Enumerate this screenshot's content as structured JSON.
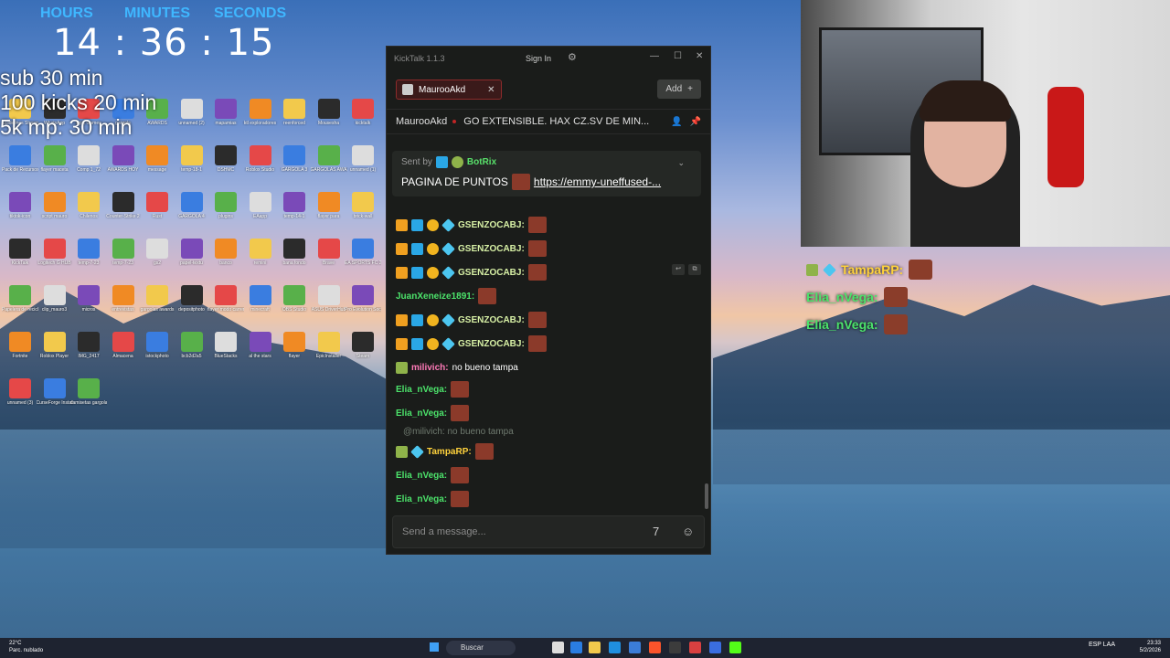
{
  "overlay": {
    "timer_labels": [
      "HOURS",
      "MINUTES",
      "SECONDS"
    ],
    "timer_value": "14 : 36 : 15",
    "lines": [
      "sub 30 min",
      "100 kicks 20 min",
      "5k mp: 30 min"
    ]
  },
  "desktop_icons": [
    "Guidelines Stream",
    "WhatsApp",
    "Epic Games",
    "gargola",
    "AWARDS",
    "unnamed (2)",
    "mapamias",
    "ktl exploradores",
    "reenforced",
    "Mousesha",
    "kicktalk",
    "Pack de Recursos",
    "flayer maceta",
    "Comp 1_72",
    "AWARDS HOY",
    "message",
    "temp-18-1",
    "DSHMC",
    "Roblox Studio",
    "GARGOLA 3",
    "GARGOLAS AWARD",
    "unnamed (1)",
    "tiktok-icon",
    "script mauro",
    "Chilenos",
    "Counter-Strike 2",
    "Rust",
    "GARGOLA 4",
    "plugins",
    "EAapp",
    "temp-14-1",
    "flayer para",
    "brick-wall",
    "KickTalk",
    "Logitech G HUB",
    "temp-7-23",
    "temp-7-23",
    "gs2",
    "papel-textu",
    "banco",
    "remini",
    "bana fondo",
    "Brave",
    "EA SPORTS FC 26",
    "Papelera de reciclaje",
    "clip_mauro3",
    "micros",
    "entrevistas",
    "gargolas awards",
    "depositphoto",
    "flayer modo carrera",
    "minecraft",
    "OBS Studio",
    "ASUS DriverHub",
    "Pro Evolution Soccer 6",
    "Fortnite",
    "Roblox Player",
    "IMG_2417",
    "Almacena",
    "istockphoto",
    "bcb2d2a5",
    "BlueStacks",
    "al the stars",
    "flayer",
    "EpicInstaller",
    "Steam",
    "unnamed (3)",
    "CurseForge Installer",
    "camisetas gargolas"
  ],
  "kicktalk": {
    "app_title": "KickTalk 1.1.3",
    "sign_in": "Sign In",
    "tab_label": "MaurooAkd",
    "add_label": "Add",
    "channel_name": "MaurooAkd",
    "stream_title": "GO EXTENSIBLE. HAX CZ.SV DE MIN...",
    "pinned": {
      "sent_by_label": "Sent by",
      "sender": "BotRix",
      "text": "PAGINA DE PUNTOS",
      "link": "https://emmy-uneffused-..."
    },
    "messages": [
      {
        "user": "GSENZOCABJ:",
        "text": ""
      },
      {
        "user": "GSENZOCABJ:",
        "text": ""
      },
      {
        "user": "GSENZOCABJ:",
        "text": ""
      },
      {
        "user": "JuanXeneize1891:",
        "text": ""
      },
      {
        "user": "GSENZOCABJ:",
        "text": ""
      },
      {
        "user": "GSENZOCABJ:",
        "text": ""
      },
      {
        "user": "milivich:",
        "text": "no bueno tampa"
      },
      {
        "user": "Elia_nVega:",
        "text": ""
      },
      {
        "user": "Elia_nVega:",
        "text": ""
      },
      {
        "user": "TampaRP:",
        "text": ""
      },
      {
        "user": "Elia_nVega:",
        "text": ""
      },
      {
        "user": "Elia_nVega:",
        "text": ""
      }
    ],
    "reply_context": "@milivich: no bueno tampa",
    "input_placeholder": "Send a message..."
  },
  "side_chat": [
    {
      "user": "TampaRP:"
    },
    {
      "user": "Elia_nVega:"
    },
    {
      "user": "Elia_nVega:"
    }
  ],
  "taskbar": {
    "weather_temp": "22°C",
    "weather_desc": "Parc. nublado",
    "search_label": "Buscar",
    "lang": "ESP LAA",
    "time": "23:33",
    "date": "5/2/2026"
  },
  "colors": {
    "accent_green": "#4ce36b",
    "tab_border": "#8c2a2a",
    "window_bg": "#1a1c1a"
  }
}
